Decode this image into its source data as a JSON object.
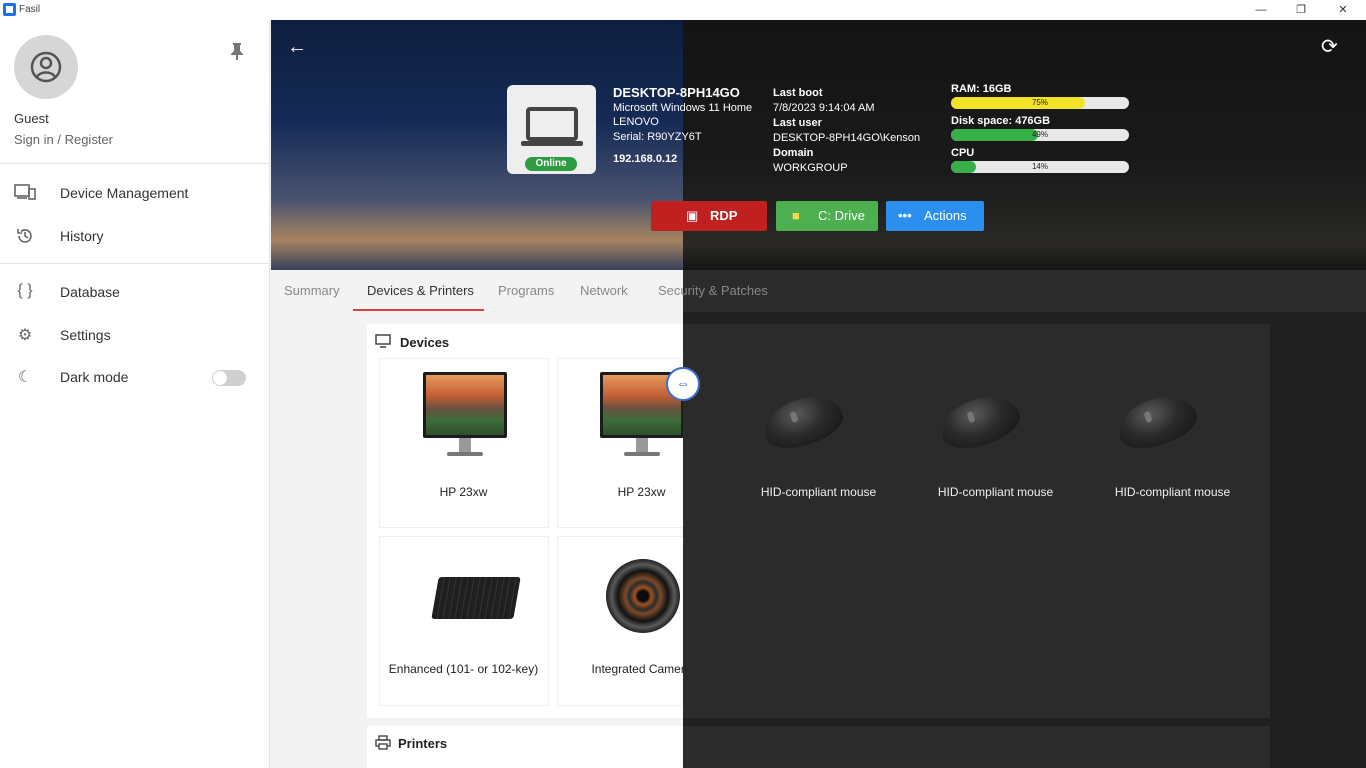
{
  "window": {
    "title": "Fasil",
    "minimize": "—",
    "maximize": "❐",
    "close": "✕"
  },
  "sidebar": {
    "user_name": "Guest",
    "sign_in": "Sign in / Register",
    "items": [
      {
        "label": "Device Management",
        "icon": "devices-icon"
      },
      {
        "label": "History",
        "icon": "history-icon"
      },
      {
        "label": "Database",
        "icon": "braces-icon"
      },
      {
        "label": "Settings",
        "icon": "gear-icon"
      },
      {
        "label": "Dark mode",
        "icon": "moon-icon"
      }
    ],
    "dark_mode_on": false
  },
  "device": {
    "hostname": "DESKTOP-8PH14GO",
    "os": "Microsoft Windows 11 Home",
    "manufacturer": "LENOVO",
    "serial": "Serial: R90YZY6T",
    "ip": "192.168.0.12",
    "status": "Online",
    "last_boot_label": "Last boot",
    "last_boot": "7/8/2023 9:14:04 AM",
    "last_user_label": "Last user",
    "last_user": "DESKTOP-8PH14GO\\Kenson",
    "domain_label": "Domain",
    "domain": "WORKGROUP"
  },
  "stats": [
    {
      "label": "RAM: 16GB",
      "percent_text": "75%",
      "percent": 75,
      "color": "#f2e22a"
    },
    {
      "label": "Disk space: 476GB",
      "percent_text": "49%",
      "percent": 49,
      "color": "#38b048"
    },
    {
      "label": "CPU",
      "percent_text": "14%",
      "percent": 14,
      "color": "#38b048"
    }
  ],
  "actions": [
    {
      "label": "RDP",
      "color": "#c0201f",
      "icon": "monitor-icon"
    },
    {
      "label": "C: Drive",
      "color": "#4caf50",
      "icon": "folder-icon"
    },
    {
      "label": "Actions",
      "color": "#2b8ff0",
      "icon": "more-icon"
    }
  ],
  "tabs": [
    "Summary",
    "Devices & Printers",
    "Programs",
    "Network",
    "Security & Patches"
  ],
  "active_tab": "Devices & Printers",
  "devices_section": {
    "title": "Devices",
    "items": [
      {
        "label": "HP 23xw",
        "icon": "monitor-image"
      },
      {
        "label": "HP 23xw",
        "icon": "monitor-image"
      },
      {
        "label": "HID-compliant mouse",
        "icon": "mouse-image"
      },
      {
        "label": "HID-compliant mouse",
        "icon": "mouse-image"
      },
      {
        "label": "HID-compliant mouse",
        "icon": "mouse-image"
      },
      {
        "label": "Enhanced (101- or 102-key)",
        "icon": "keyboard-image"
      },
      {
        "label": "Integrated Camera",
        "icon": "camera-image"
      }
    ]
  },
  "printers_section": {
    "title": "Printers"
  },
  "colors": {
    "accent_tab": "#d94040",
    "online": "#2e9c42",
    "compare_handle": "#3b6fd1"
  }
}
